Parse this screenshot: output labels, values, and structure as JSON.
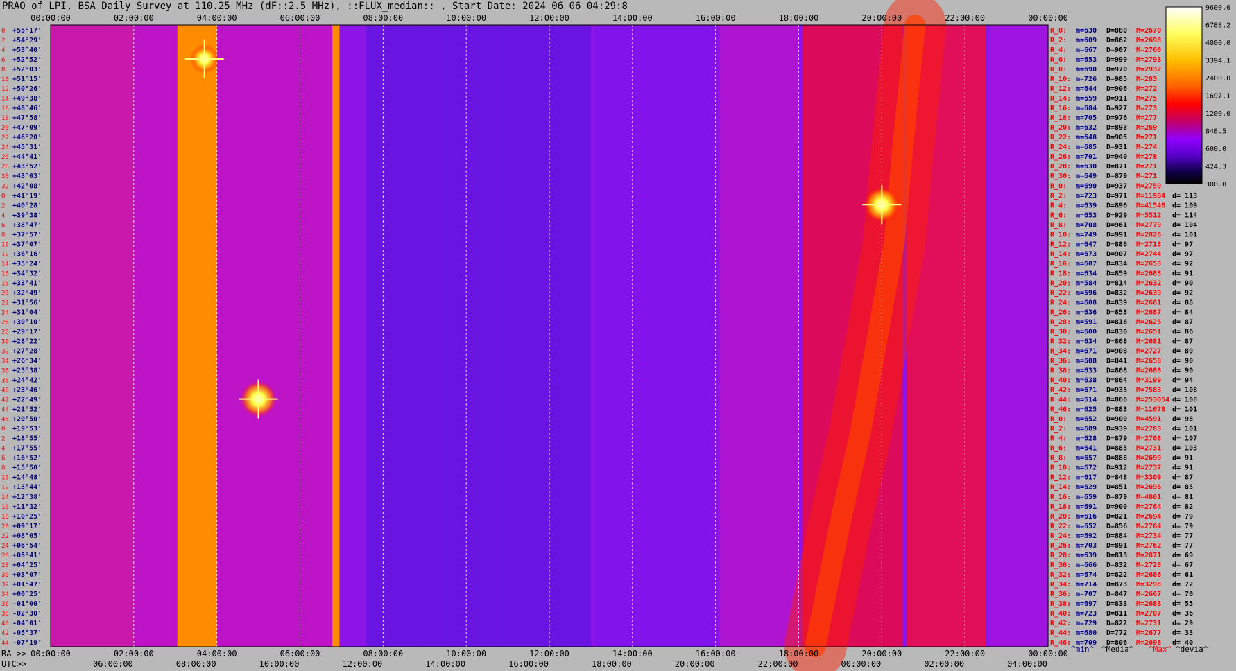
{
  "title": "PRAO of LPI, BSA Daily Survey at 110.25 MHz (dF::2.5 MHz), ::FLUX_median:: , Start Date: 2024 06 06 04:29:8",
  "bottom_labels": {
    "ra_prefix": "RA >>",
    "utc_prefix": "UTC>>"
  },
  "legend_footer": {
    "min": "^min^",
    "media": "^Media^",
    "max": "^Max^",
    "devia": "^devia^"
  },
  "colors": {
    "min": "#00008b",
    "media": "#000000",
    "max": "#ff0000",
    "devia": "#000000",
    "label_blue": "#000080",
    "label_red": "#ff0000"
  },
  "chart_data": {
    "type": "heatmap",
    "title": "PRAO of LPI, BSA Daily Survey at 110.25 MHz (dF::2.5 MHz), ::FLUX_median:: , Start Date: 2024 06 06 04:29:8",
    "x_top_ticks": [
      "00:00:00",
      "02:00:00",
      "04:00:00",
      "06:00:00",
      "08:00:00",
      "10:00:00",
      "12:00:00",
      "14:00:00",
      "16:00:00",
      "18:00:00",
      "20:00:00",
      "22:00:00",
      "00:00:00"
    ],
    "x_bottom_ra_ticks": [
      "00:00:00",
      "02:00:00",
      "04:00:00",
      "06:00:00",
      "08:00:00",
      "10:00:00",
      "12:00:00",
      "14:00:00",
      "16:00:00",
      "18:00:00",
      "20:00:00",
      "22:00:00",
      "00:00:00"
    ],
    "x_bottom_utc_ticks": [
      "06:00:00",
      "08:00:00",
      "10:00:00",
      "12:00:00",
      "14:00:00",
      "16:00:00",
      "18:00:00",
      "20:00:00",
      "22:00:00",
      "00:00:00",
      "02:00:00",
      "04:00:00"
    ],
    "colorbar": {
      "labels": [
        "9600.0",
        "6788.2",
        "4800.0",
        "3394.1",
        "2400.0",
        "1697.1",
        "1200.0",
        "848.5",
        "600.0",
        "424.3",
        "300.0"
      ],
      "colors": [
        "#ffffff",
        "#ffff80",
        "#ffff00",
        "#ffc000",
        "#ff8000",
        "#ff0000",
        "#c00060",
        "#9000ff",
        "#6000d0",
        "#000040",
        "#000000"
      ]
    },
    "grid": true,
    "beams": [
      {
        "idx": "0",
        "dec": "+55°17'"
      },
      {
        "idx": "2",
        "dec": "+54°29'"
      },
      {
        "idx": "4",
        "dec": "+53°40'"
      },
      {
        "idx": "6",
        "dec": "+52°52'"
      },
      {
        "idx": "8",
        "dec": "+52°03'"
      },
      {
        "idx": "10",
        "dec": "+51°15'"
      },
      {
        "idx": "12",
        "dec": "+50°26'"
      },
      {
        "idx": "14",
        "dec": "+49°38'"
      },
      {
        "idx": "16",
        "dec": "+48°46'"
      },
      {
        "idx": "18",
        "dec": "+47°58'"
      },
      {
        "idx": "20",
        "dec": "+47°09'"
      },
      {
        "idx": "22",
        "dec": "+46°20'"
      },
      {
        "idx": "24",
        "dec": "+45°31'"
      },
      {
        "idx": "26",
        "dec": "+44°41'"
      },
      {
        "idx": "28",
        "dec": "+43°52'"
      },
      {
        "idx": "30",
        "dec": "+43°03'"
      },
      {
        "idx": "32",
        "dec": "+42°08'"
      },
      {
        "idx": "0",
        "dec": "+41°19'"
      },
      {
        "idx": "2",
        "dec": "+40°28'"
      },
      {
        "idx": "4",
        "dec": "+39°38'"
      },
      {
        "idx": "6",
        "dec": "+38°47'"
      },
      {
        "idx": "8",
        "dec": "+37°57'"
      },
      {
        "idx": "10",
        "dec": "+37°07'"
      },
      {
        "idx": "12",
        "dec": "+36°16'"
      },
      {
        "idx": "14",
        "dec": "+35°24'"
      },
      {
        "idx": "16",
        "dec": "+34°32'"
      },
      {
        "idx": "18",
        "dec": "+33°41'"
      },
      {
        "idx": "20",
        "dec": "+32°49'"
      },
      {
        "idx": "22",
        "dec": "+31°56'"
      },
      {
        "idx": "24",
        "dec": "+31°04'"
      },
      {
        "idx": "26",
        "dec": "+30°10'"
      },
      {
        "idx": "28",
        "dec": "+29°17'"
      },
      {
        "idx": "30",
        "dec": "+28°22'"
      },
      {
        "idx": "32",
        "dec": "+27°28'"
      },
      {
        "idx": "34",
        "dec": "+26°34'"
      },
      {
        "idx": "36",
        "dec": "+25°38'"
      },
      {
        "idx": "38",
        "dec": "+24°42'"
      },
      {
        "idx": "40",
        "dec": "+23°46'"
      },
      {
        "idx": "42",
        "dec": "+22°49'"
      },
      {
        "idx": "44",
        "dec": "+21°52'"
      },
      {
        "idx": "46",
        "dec": "+20°50'"
      },
      {
        "idx": "0",
        "dec": "+19°53'"
      },
      {
        "idx": "2",
        "dec": "+18°55'"
      },
      {
        "idx": "4",
        "dec": "+17°55'"
      },
      {
        "idx": "6",
        "dec": "+16°52'"
      },
      {
        "idx": "8",
        "dec": "+15°50'"
      },
      {
        "idx": "10",
        "dec": "+14°48'"
      },
      {
        "idx": "12",
        "dec": "+13°44'"
      },
      {
        "idx": "14",
        "dec": "+12°38'"
      },
      {
        "idx": "16",
        "dec": "+11°32'"
      },
      {
        "idx": "18",
        "dec": "+10°25'"
      },
      {
        "idx": "20",
        "dec": "+09°17'"
      },
      {
        "idx": "22",
        "dec": "+08°05'"
      },
      {
        "idx": "24",
        "dec": "+06°54'"
      },
      {
        "idx": "26",
        "dec": "+05°41'"
      },
      {
        "idx": "28",
        "dec": "+04°25'"
      },
      {
        "idx": "30",
        "dec": "+03°07'"
      },
      {
        "idx": "32",
        "dec": "+01°47'"
      },
      {
        "idx": "34",
        "dec": "+00°25'"
      },
      {
        "idx": "36",
        "dec": "-01°00'"
      },
      {
        "idx": "38",
        "dec": "-02°30'"
      },
      {
        "idx": "40",
        "dec": "-04°01'"
      },
      {
        "idx": "42",
        "dec": "-05°37'"
      },
      {
        "idx": "44",
        "dec": "-07°19'"
      }
    ],
    "stats": [
      {
        "r": "R_0:",
        "min": "m=630",
        "med": "D=880",
        "max": "M=2670",
        "dev": ""
      },
      {
        "r": "R_2:",
        "min": "m=609",
        "med": "D=862",
        "max": "M=2698",
        "dev": ""
      },
      {
        "r": "R_4:",
        "min": "m=667",
        "med": "D=907",
        "max": "M=2760",
        "dev": ""
      },
      {
        "r": "R_6:",
        "min": "m=653",
        "med": "D=999",
        "max": "M=2793",
        "dev": ""
      },
      {
        "r": "R_8:",
        "min": "m=690",
        "med": "D=970",
        "max": "M=2932",
        "dev": ""
      },
      {
        "r": "R_10:",
        "min": "m=726",
        "med": "D=985",
        "max": "M=283",
        "dev": ""
      },
      {
        "r": "R_12:",
        "min": "m=644",
        "med": "D=906",
        "max": "M=272",
        "dev": ""
      },
      {
        "r": "R_14:",
        "min": "m=659",
        "med": "D=911",
        "max": "M=275",
        "dev": ""
      },
      {
        "r": "R_16:",
        "min": "m=684",
        "med": "D=927",
        "max": "M=273",
        "dev": ""
      },
      {
        "r": "R_18:",
        "min": "m=705",
        "med": "D=976",
        "max": "M=277",
        "dev": ""
      },
      {
        "r": "R_20:",
        "min": "m=632",
        "med": "D=893",
        "max": "M=269",
        "dev": ""
      },
      {
        "r": "R_22:",
        "min": "m=648",
        "med": "D=905",
        "max": "M=271",
        "dev": ""
      },
      {
        "r": "R_24:",
        "min": "m=685",
        "med": "D=931",
        "max": "M=274",
        "dev": ""
      },
      {
        "r": "R_26:",
        "min": "m=701",
        "med": "D=940",
        "max": "M=278",
        "dev": ""
      },
      {
        "r": "R_28:",
        "min": "m=630",
        "med": "D=871",
        "max": "M=271",
        "dev": ""
      },
      {
        "r": "R_30:",
        "min": "m=649",
        "med": "D=879",
        "max": "M=271",
        "dev": ""
      },
      {
        "r": "R_0:",
        "min": "m=690",
        "med": "D=937",
        "max": "M=2759",
        "dev": ""
      },
      {
        "r": "R_2:",
        "min": "m=723",
        "med": "D=971",
        "max": "M=11984",
        "dev": "d= 113"
      },
      {
        "r": "R_4:",
        "min": "m=639",
        "med": "D=896",
        "max": "M=41546",
        "dev": "d= 109"
      },
      {
        "r": "R_6:",
        "min": "m=653",
        "med": "D=929",
        "max": "M=5512",
        "dev": "d= 114"
      },
      {
        "r": "R_8:",
        "min": "m=708",
        "med": "D=961",
        "max": "M=2779",
        "dev": "d= 104"
      },
      {
        "r": "R_10:",
        "min": "m=749",
        "med": "D=991",
        "max": "M=2826",
        "dev": "d= 101"
      },
      {
        "r": "R_12:",
        "min": "m=647",
        "med": "D=886",
        "max": "M=2718",
        "dev": "d= 97"
      },
      {
        "r": "R_14:",
        "min": "m=673",
        "med": "D=907",
        "max": "M=2744",
        "dev": "d= 97"
      },
      {
        "r": "R_16:",
        "min": "m=607",
        "med": "D=834",
        "max": "M=2653",
        "dev": "d= 92"
      },
      {
        "r": "R_18:",
        "min": "m=634",
        "med": "D=859",
        "max": "M=2683",
        "dev": "d= 91"
      },
      {
        "r": "R_20:",
        "min": "m=584",
        "med": "D=814",
        "max": "M=2632",
        "dev": "d= 90"
      },
      {
        "r": "R_22:",
        "min": "m=596",
        "med": "D=832",
        "max": "M=2639",
        "dev": "d= 92"
      },
      {
        "r": "R_24:",
        "min": "m=608",
        "med": "D=839",
        "max": "M=2661",
        "dev": "d= 88"
      },
      {
        "r": "R_26:",
        "min": "m=636",
        "med": "D=853",
        "max": "M=2687",
        "dev": "d= 84"
      },
      {
        "r": "R_28:",
        "min": "m=591",
        "med": "D=816",
        "max": "M=2625",
        "dev": "d= 87"
      },
      {
        "r": "R_30:",
        "min": "m=600",
        "med": "D=830",
        "max": "M=2651",
        "dev": "d= 86"
      },
      {
        "r": "R_32:",
        "min": "m=634",
        "med": "D=868",
        "max": "M=2681",
        "dev": "d= 87"
      },
      {
        "r": "R_34:",
        "min": "m=671",
        "med": "D=908",
        "max": "M=2727",
        "dev": "d= 89"
      },
      {
        "r": "R_36:",
        "min": "m=608",
        "med": "D=841",
        "max": "M=2658",
        "dev": "d= 90"
      },
      {
        "r": "R_38:",
        "min": "m=633",
        "med": "D=868",
        "max": "M=2688",
        "dev": "d= 90"
      },
      {
        "r": "R_40:",
        "min": "m=638",
        "med": "D=864",
        "max": "M=3199",
        "dev": "d= 94"
      },
      {
        "r": "R_42:",
        "min": "m=671",
        "med": "D=935",
        "max": "M=7583",
        "dev": "d= 108"
      },
      {
        "r": "R_44:",
        "min": "m=614",
        "med": "D=866",
        "max": "M=253054",
        "dev": "d= 108"
      },
      {
        "r": "R_46:",
        "min": "m=625",
        "med": "D=883",
        "max": "M=11678",
        "dev": "d= 101"
      },
      {
        "r": "R_0:",
        "min": "m=652",
        "med": "D=900",
        "max": "M=4591",
        "dev": "d= 98"
      },
      {
        "r": "R_2:",
        "min": "m=689",
        "med": "D=939",
        "max": "M=2763",
        "dev": "d= 101"
      },
      {
        "r": "R_4:",
        "min": "m=628",
        "med": "D=879",
        "max": "M=2708",
        "dev": "d= 107"
      },
      {
        "r": "R_6:",
        "min": "m=641",
        "med": "D=885",
        "max": "M=2731",
        "dev": "d= 103"
      },
      {
        "r": "R_8:",
        "min": "m=657",
        "med": "D=888",
        "max": "M=2699",
        "dev": "d= 91"
      },
      {
        "r": "R_10:",
        "min": "m=672",
        "med": "D=912",
        "max": "M=2737",
        "dev": "d= 91"
      },
      {
        "r": "R_12:",
        "min": "m=617",
        "med": "D=848",
        "max": "M=3309",
        "dev": "d= 87"
      },
      {
        "r": "R_14:",
        "min": "m=629",
        "med": "D=851",
        "max": "M=2696",
        "dev": "d= 85"
      },
      {
        "r": "R_16:",
        "min": "m=659",
        "med": "D=879",
        "max": "M=4861",
        "dev": "d= 81"
      },
      {
        "r": "R_18:",
        "min": "m=691",
        "med": "D=900",
        "max": "M=2764",
        "dev": "d= 82"
      },
      {
        "r": "R_20:",
        "min": "m=616",
        "med": "D=821",
        "max": "M=2694",
        "dev": "d= 79"
      },
      {
        "r": "R_22:",
        "min": "m=652",
        "med": "D=856",
        "max": "M=2764",
        "dev": "d= 79"
      },
      {
        "r": "R_24:",
        "min": "m=692",
        "med": "D=884",
        "max": "M=2734",
        "dev": "d= 77"
      },
      {
        "r": "R_26:",
        "min": "m=703",
        "med": "D=891",
        "max": "M=2762",
        "dev": "d= 77"
      },
      {
        "r": "R_28:",
        "min": "m=639",
        "med": "D=813",
        "max": "M=2871",
        "dev": "d= 69"
      },
      {
        "r": "R_30:",
        "min": "m=666",
        "med": "D=832",
        "max": "M=2728",
        "dev": "d= 67"
      },
      {
        "r": "R_32:",
        "min": "m=674",
        "med": "D=822",
        "max": "M=2686",
        "dev": "d= 61"
      },
      {
        "r": "R_34:",
        "min": "m=714",
        "med": "D=873",
        "max": "M=3298",
        "dev": "d= 72"
      },
      {
        "r": "R_36:",
        "min": "m=707",
        "med": "D=847",
        "max": "M=2667",
        "dev": "d= 70"
      },
      {
        "r": "R_38:",
        "min": "m=697",
        "med": "D=833",
        "max": "M=2683",
        "dev": "d= 55"
      },
      {
        "r": "R_40:",
        "min": "m=723",
        "med": "D=811",
        "max": "M=2707",
        "dev": "d= 36"
      },
      {
        "r": "R_42:",
        "min": "m=729",
        "med": "D=822",
        "max": "M=2731",
        "dev": "d= 29"
      },
      {
        "r": "R_44:",
        "min": "m=680",
        "med": "D=772",
        "max": "M=2677",
        "dev": "d= 33"
      },
      {
        "r": "R_46:",
        "min": "m=709",
        "med": "D=806",
        "max": "M=2698",
        "dev": "d= 40"
      }
    ],
    "sources": [
      {
        "ra_h": 5.0,
        "row": 38,
        "level": 1.0
      },
      {
        "ra_h": 20.0,
        "row": 18,
        "level": 1.0
      },
      {
        "ra_h": 3.7,
        "row": 3,
        "level": 0.8
      }
    ]
  }
}
